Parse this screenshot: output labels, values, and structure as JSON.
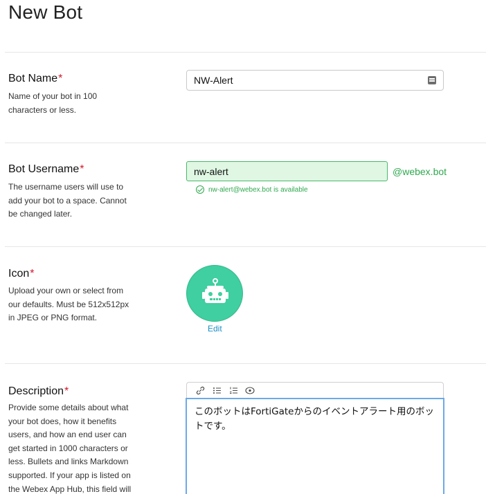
{
  "page": {
    "title": "New Bot"
  },
  "bot_name": {
    "label": "Bot Name",
    "required_marker": "*",
    "help": "Name of your bot in 100 characters or less.",
    "value": "NW-Alert"
  },
  "bot_username": {
    "label": "Bot Username",
    "required_marker": "*",
    "help": "The username users will use to add your bot to a space. Cannot be changed later.",
    "value": "nw-alert",
    "suffix": "@webex.bot",
    "availability": "nw-alert@webex.bot is available"
  },
  "icon": {
    "label": "Icon",
    "required_marker": "*",
    "help": "Upload your own or select from our defaults. Must be 512x512px in JPEG or PNG format.",
    "edit_label": "Edit",
    "avatar_icon": "robot-icon",
    "avatar_color": "#3fcfa0"
  },
  "description": {
    "label": "Description",
    "required_marker": "*",
    "help": "Provide some details about what your bot does, how it benefits users, and how an end user can get started in 1000 characters or less. Bullets and links Markdown supported. If your app is listed on the Webex App Hub, this field will",
    "toolbar": [
      "link-icon",
      "bulleted-list-icon",
      "numbered-list-icon",
      "preview-eye-icon"
    ],
    "value": "このボットはFortiGateからのイベントアラート用のボットです。"
  },
  "colors": {
    "success": "#2ea84d",
    "link": "#1c8fc4",
    "required": "#d5172b",
    "focus": "#6aa9e8"
  }
}
